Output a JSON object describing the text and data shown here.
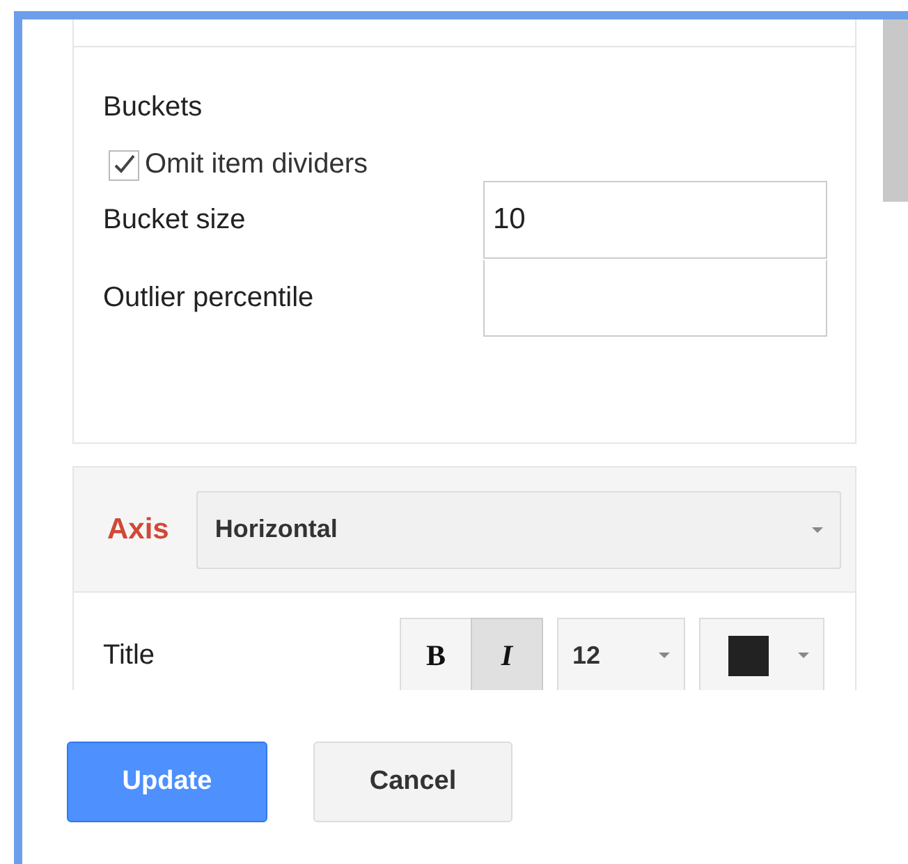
{
  "buckets": {
    "heading": "Buckets",
    "omit_dividers": {
      "label": "Omit item dividers",
      "checked": true
    },
    "fields": [
      {
        "label": "Bucket size",
        "value": "10"
      },
      {
        "label": "Outlier percentile"
      }
    ]
  },
  "axis": {
    "label": "Axis",
    "dropdown": {
      "value": "Horizontal"
    },
    "title_row": {
      "label": "Title",
      "bold": {
        "text": "B",
        "selected": false
      },
      "italic": {
        "text": "I",
        "selected": true
      },
      "font_size": "12",
      "text_color": {
        "color": "#222222"
      }
    }
  },
  "buttons": [
    {
      "label": "Update",
      "kind": "primary"
    },
    {
      "label": "Cancel",
      "kind": "secondary"
    }
  ]
}
